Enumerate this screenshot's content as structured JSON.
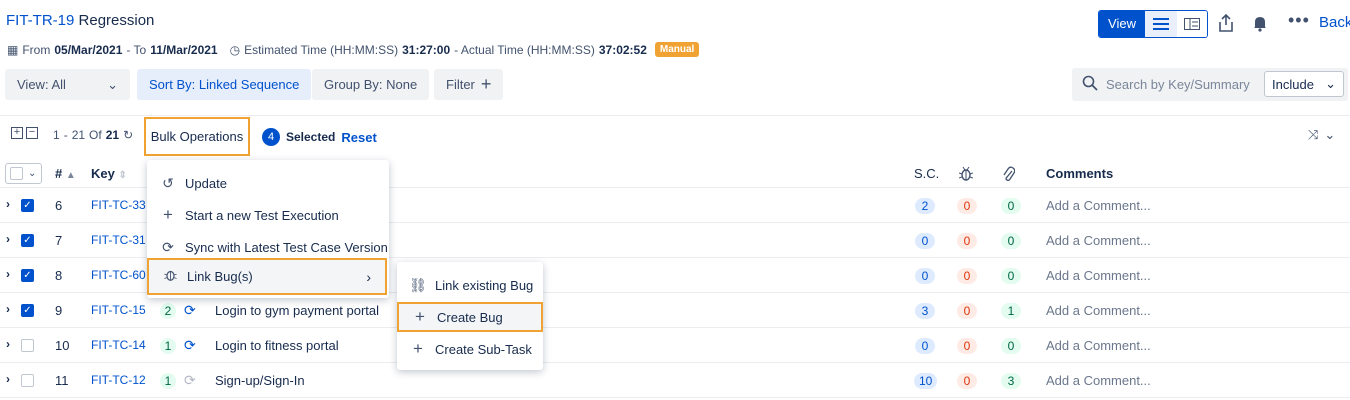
{
  "header": {
    "key": "FIT-TR-19",
    "name": "Regression",
    "from_label": "From",
    "from_date": "05/Mar/2021",
    "to_label": "- To",
    "to_date": "11/Mar/2021",
    "est_label": "Estimated Time (HH:MM:SS)",
    "est_value": "31:27:00",
    "act_label": "- Actual Time (HH:MM:SS)",
    "act_value": "37:02:52",
    "type_badge": "Manual",
    "view_button": "View",
    "back_label": "Back"
  },
  "filters": {
    "view": "View: All",
    "sort": "Sort By: Linked Sequence",
    "group": "Group By: None",
    "filter": "Filter",
    "search_placeholder": "Search by Key/Summary",
    "include": "Include"
  },
  "toolbar": {
    "range_start": "1",
    "range_sep": "-",
    "range_end": "21",
    "of_label": "Of",
    "total": "21",
    "bulk_ops": "Bulk Operations",
    "selected_count": "4",
    "selected_label": "Selected",
    "reset_label": "Reset"
  },
  "table": {
    "headers": {
      "num": "#",
      "key": "Key",
      "sc": "S.C.",
      "comments": "Comments"
    },
    "rows": [
      {
        "checked": true,
        "num": "6",
        "key": "FIT-TC-33",
        "version": "",
        "summary": "",
        "sc": "2",
        "bugs": "0",
        "attachments": "0",
        "comment": "Add a Comment..."
      },
      {
        "checked": true,
        "num": "7",
        "key": "FIT-TC-31",
        "version": "",
        "summary": "",
        "sc": "0",
        "bugs": "0",
        "attachments": "0",
        "comment": "Add a Comment..."
      },
      {
        "checked": true,
        "num": "8",
        "key": "FIT-TC-60",
        "version": "",
        "summary": "",
        "sc": "0",
        "bugs": "0",
        "attachments": "0",
        "comment": "Add a Comment..."
      },
      {
        "checked": true,
        "num": "9",
        "key": "FIT-TC-15",
        "version": "2",
        "summary": "Login to gym payment portal",
        "sc": "3",
        "bugs": "0",
        "attachments": "1",
        "comment": "Add a Comment..."
      },
      {
        "checked": false,
        "num": "10",
        "key": "FIT-TC-14",
        "version": "1",
        "summary": "Login to fitness portal",
        "sc": "0",
        "bugs": "0",
        "attachments": "0",
        "comment": "Add a Comment..."
      },
      {
        "checked": false,
        "num": "11",
        "key": "FIT-TC-12",
        "version": "1",
        "summary": "Sign-up/Sign-In",
        "sc": "10",
        "bugs": "0",
        "attachments": "3",
        "comment": "Add a Comment..."
      }
    ]
  },
  "bulk_menu": {
    "items": [
      {
        "icon": "refresh-icon",
        "label": "Update"
      },
      {
        "icon": "plus-icon",
        "label": "Start a new Test Execution"
      },
      {
        "icon": "sync-icon",
        "label": "Sync with Latest Test Case Version"
      },
      {
        "icon": "bug-icon",
        "label": "Link Bug(s)"
      }
    ]
  },
  "bug_submenu": {
    "items": [
      {
        "icon": "link-icon",
        "label": "Link existing Bug"
      },
      {
        "icon": "plus-icon",
        "label": "Create Bug"
      },
      {
        "icon": "plus-icon",
        "label": "Create Sub-Task"
      }
    ]
  },
  "colors": {
    "accent": "#0052cc",
    "highlight": "#f0a332",
    "manual_badge": "#f0a332"
  }
}
